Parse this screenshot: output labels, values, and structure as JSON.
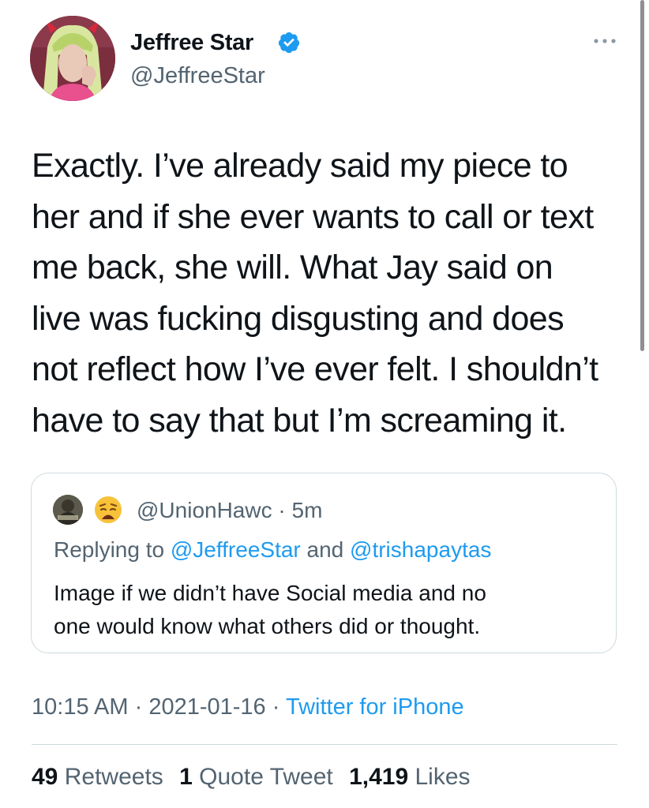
{
  "author": {
    "display_name": "Jeffree Star",
    "handle": "@JeffreeStar",
    "verified": true
  },
  "tweet": {
    "text": "Exactly. I’ve already said my piece to\nher and if she ever wants to call or text\nme back, she will. What Jay said on\nlive was fucking disgusting and does\nnot reflect how I’ve ever felt. I shouldn’t\nhave to say that but I’m screaming it."
  },
  "quoted_tweet": {
    "handle": "@UnionHawc",
    "separator": "·",
    "time": "5m",
    "emoji": "😩",
    "replying_prefix": "Replying to",
    "replying_to_1": "@JeffreeStar",
    "replying_and": "and",
    "replying_to_2": "@trishapaytas",
    "text": "Image if we didn’t have Social media and no\none would know what others did or thought."
  },
  "meta": {
    "time": "10:15 AM",
    "date": "2021-01-16",
    "separator": "·",
    "source": "Twitter for iPhone"
  },
  "stats": {
    "retweets_count": "49",
    "retweets_label": "Retweets",
    "quotes_count": "1",
    "quotes_label": "Quote Tweet",
    "likes_count": "1,419",
    "likes_label": "Likes"
  },
  "colors": {
    "link_blue": "#1d9bf0",
    "secondary_text": "#536471",
    "primary_text": "#0f1419",
    "border": "#cfd9de"
  },
  "icons": [
    "verified-badge-icon",
    "more-options-icon"
  ]
}
